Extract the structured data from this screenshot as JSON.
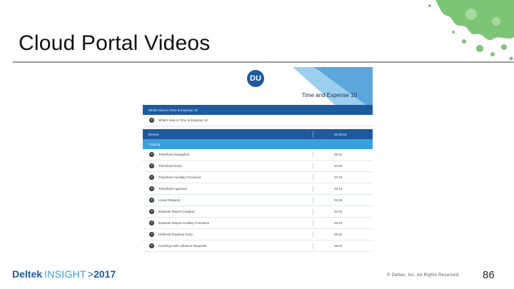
{
  "slide": {
    "title": "Cloud Portal Videos",
    "page_number": "86"
  },
  "footer": {
    "brand_deltek": "Deltek",
    "brand_insight": "INSIGHT",
    "brand_chevron": ">",
    "brand_year": "2017",
    "copyright": "© Deltek, Inc. All Rights Reserved"
  },
  "screenshot": {
    "logo": "DU",
    "app_title": "Time and Expense 10",
    "whats_new_header": "What's New in Time & Expense 10",
    "whats_new_video": "What's New in Time & Expense 10",
    "demos_header": "Demos",
    "demos_duration": "00:35:18",
    "training_header": "Training",
    "videos": [
      {
        "title": "Timesheet Navigation",
        "duration": "08:21"
      },
      {
        "title": "Timesheet Entry",
        "duration": "04:25"
      },
      {
        "title": "Timesheet Ancillary Functions",
        "duration": "07:15"
      },
      {
        "title": "Timesheet Approval",
        "duration": "03:12"
      },
      {
        "title": "Leave Request",
        "duration": "03:45"
      },
      {
        "title": "Expense Report Creation",
        "duration": "04:32"
      },
      {
        "title": "Expense Report Ancillary Functions",
        "duration": "03:24"
      },
      {
        "title": "Deferred Expense Entry",
        "duration": "06:22"
      },
      {
        "title": "Creating Cash Advance Requests",
        "duration": "06:22"
      }
    ]
  },
  "colors": {
    "accent_blue": "#1e5aa0",
    "light_blue": "#3aa0dc",
    "splash_green": "#7cc576"
  }
}
